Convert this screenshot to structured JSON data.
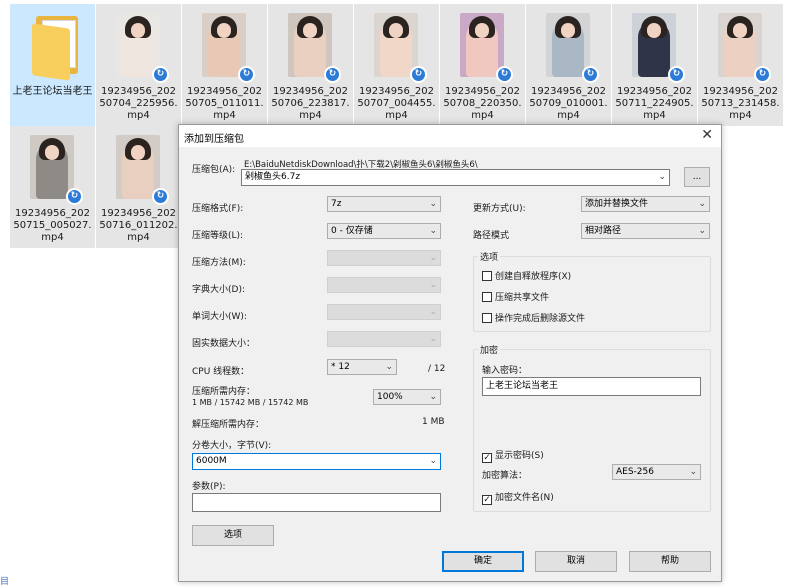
{
  "explorer": {
    "folder": {
      "name": "上老王论坛当老王"
    },
    "files": [
      {
        "name": "19234956_20250704_225956.mp4",
        "bg": "#e9e7e4",
        "skin": "#efe6df"
      },
      {
        "name": "19234956_20250705_011011.mp4",
        "bg": "#d9cfc8",
        "skin": "#e8c9b6"
      },
      {
        "name": "19234956_20250706_223817.mp4",
        "bg": "#cfc6bf",
        "skin": "#ead0c0"
      },
      {
        "name": "19234956_20250707_004455.mp4",
        "bg": "#dbd5cf",
        "skin": "#f1d7c8"
      },
      {
        "name": "19234956_20250708_220350.mp4",
        "bg": "#c9a9c6",
        "skin": "#f0c8c0"
      },
      {
        "name": "19234956_20250709_010001.mp4",
        "bg": "#d2d4d6",
        "skin": "#aab8c6"
      },
      {
        "name": "19234956_20250711_224905.mp4",
        "bg": "#cdd1d8",
        "skin": "#2f3448"
      },
      {
        "name": "19234956_20250713_231458.mp4",
        "bg": "#d9d4cf",
        "skin": "#ecd1c2"
      },
      {
        "name": "19234956_20250715_005027.mp4",
        "bg": "#cfc9c3",
        "skin": "#8e8b86"
      },
      {
        "name": "19234956_20250716_011202.mp4",
        "bg": "#d3ccc6",
        "skin": "#e9cfc0"
      }
    ],
    "badge_glyph": "↻",
    "side_mark": "目"
  },
  "dialog": {
    "title": "添加到压缩包",
    "close_glyph": "✕",
    "archive_label": "压缩包(A):",
    "archive_path": "E:\\BaiduNetdiskDownload\\扑\\下载2\\剁椒鱼头6\\剁椒鱼头6\\",
    "archive_name": "剁椒鱼头6.7z",
    "browse": "...",
    "format_label": "压缩格式(F):",
    "format_value": "7z",
    "level_label": "压缩等级(L):",
    "level_value": "0 - 仅存储",
    "method_label": "压缩方法(M):",
    "dict_label": "字典大小(D):",
    "word_label": "单词大小(W):",
    "solid_label": "固实数据大小：",
    "cpu_label": "CPU 线程数：",
    "cpu_value": "* 12",
    "cpu_total": "/ 12",
    "mem_label": "压缩所需内存：",
    "mem_value": "1 MB / 15742 MB / 15742 MB",
    "mem_percent": "100%",
    "decomp_label": "解压缩所需内存：",
    "decomp_value": "1 MB",
    "split_label": "分卷大小，字节(V):",
    "split_value": "6000M",
    "params_label": "参数(P):",
    "params_value": "",
    "options_button": "选项",
    "update_label": "更新方式(U):",
    "update_value": "添加并替换文件",
    "pathmode_label": "路径模式",
    "pathmode_value": "相对路径",
    "options_group": "选项",
    "opt_sfx": "创建自释放程序(X)",
    "opt_shared": "压缩共享文件",
    "opt_delete": "操作完成后删除源文件",
    "encrypt_group": "加密",
    "password_label": "输入密码：",
    "password_value": "上老王论坛当老王",
    "show_password": "显示密码(S)",
    "enc_method_label": "加密算法：",
    "enc_method_value": "AES-256",
    "encrypt_names": "加密文件名(N)",
    "ok": "确定",
    "cancel": "取消",
    "help": "帮助",
    "check_glyph": "✓",
    "chevron_glyph": "⌄"
  }
}
